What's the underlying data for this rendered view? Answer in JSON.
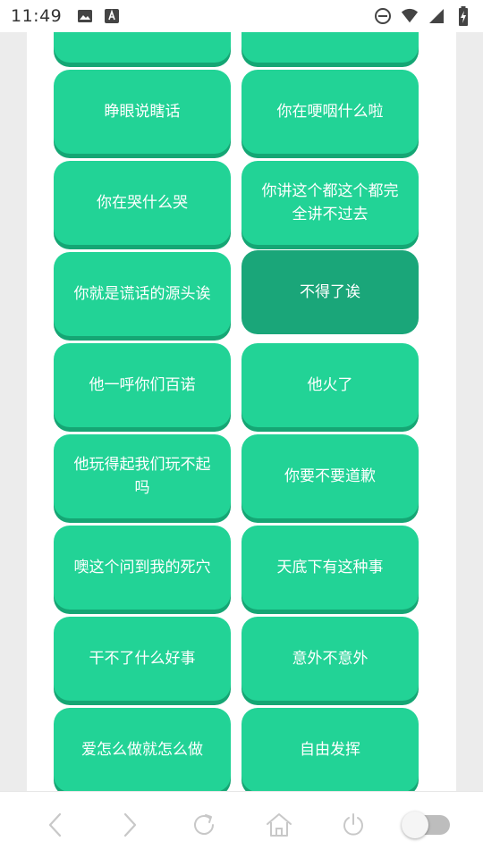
{
  "status_bar": {
    "time": "11:49",
    "icons": [
      "image-icon",
      "font-download-icon",
      "do-not-disturb-icon",
      "wifi-icon",
      "signal-icon",
      "battery-charging-icon"
    ]
  },
  "buttons": [
    {
      "label": ""
    },
    {
      "label": ""
    },
    {
      "label": "睁眼说瞎话"
    },
    {
      "label": "你在哽咽什么啦"
    },
    {
      "label": "你在哭什么哭"
    },
    {
      "label": "你讲这个都这个都完全讲不过去"
    },
    {
      "label": "你就是谎话的源头诶"
    },
    {
      "label": "不得了诶",
      "pressed": true
    },
    {
      "label": "他一呼你们百诺"
    },
    {
      "label": "他火了"
    },
    {
      "label": "他玩得起我们玩不起吗"
    },
    {
      "label": "你要不要道歉"
    },
    {
      "label": "噢这个问到我的死穴"
    },
    {
      "label": "天底下有这种事"
    },
    {
      "label": "干不了什么好事"
    },
    {
      "label": "意外不意外"
    },
    {
      "label": "爱怎么做就怎么做"
    },
    {
      "label": "自由发挥"
    },
    {
      "label": ""
    },
    {
      "label": ""
    }
  ],
  "bottom_nav": {
    "items": [
      "back-icon",
      "forward-icon",
      "refresh-icon",
      "home-icon",
      "power-icon"
    ],
    "toggle_on": false
  },
  "colors": {
    "button": "#22d396",
    "button_shadow": "#15a674",
    "button_pressed": "#1aa679"
  }
}
